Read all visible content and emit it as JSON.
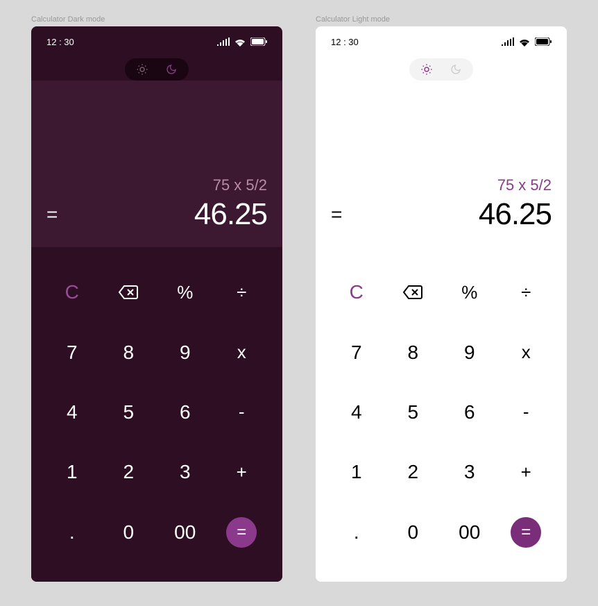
{
  "panels": {
    "dark": {
      "label": "Calculator Dark mode"
    },
    "light": {
      "label": "Calculator Light mode"
    }
  },
  "status": {
    "time": "12 : 30"
  },
  "display": {
    "expression": "75 x 5/2",
    "equals": "=",
    "result": "46.25"
  },
  "keys": {
    "clear": "C",
    "percent": "%",
    "divide": "÷",
    "k7": "7",
    "k8": "8",
    "k9": "9",
    "multiply": "x",
    "k4": "4",
    "k5": "5",
    "k6": "6",
    "minus": "-",
    "k1": "1",
    "k2": "2",
    "k3": "3",
    "plus": "+",
    "dot": ".",
    "k0": "0",
    "k00": "00",
    "equals": "="
  },
  "colors": {
    "accent": "#8b3a8b",
    "dark_bg": "#2d0e22",
    "dark_display": "#3d1831"
  }
}
